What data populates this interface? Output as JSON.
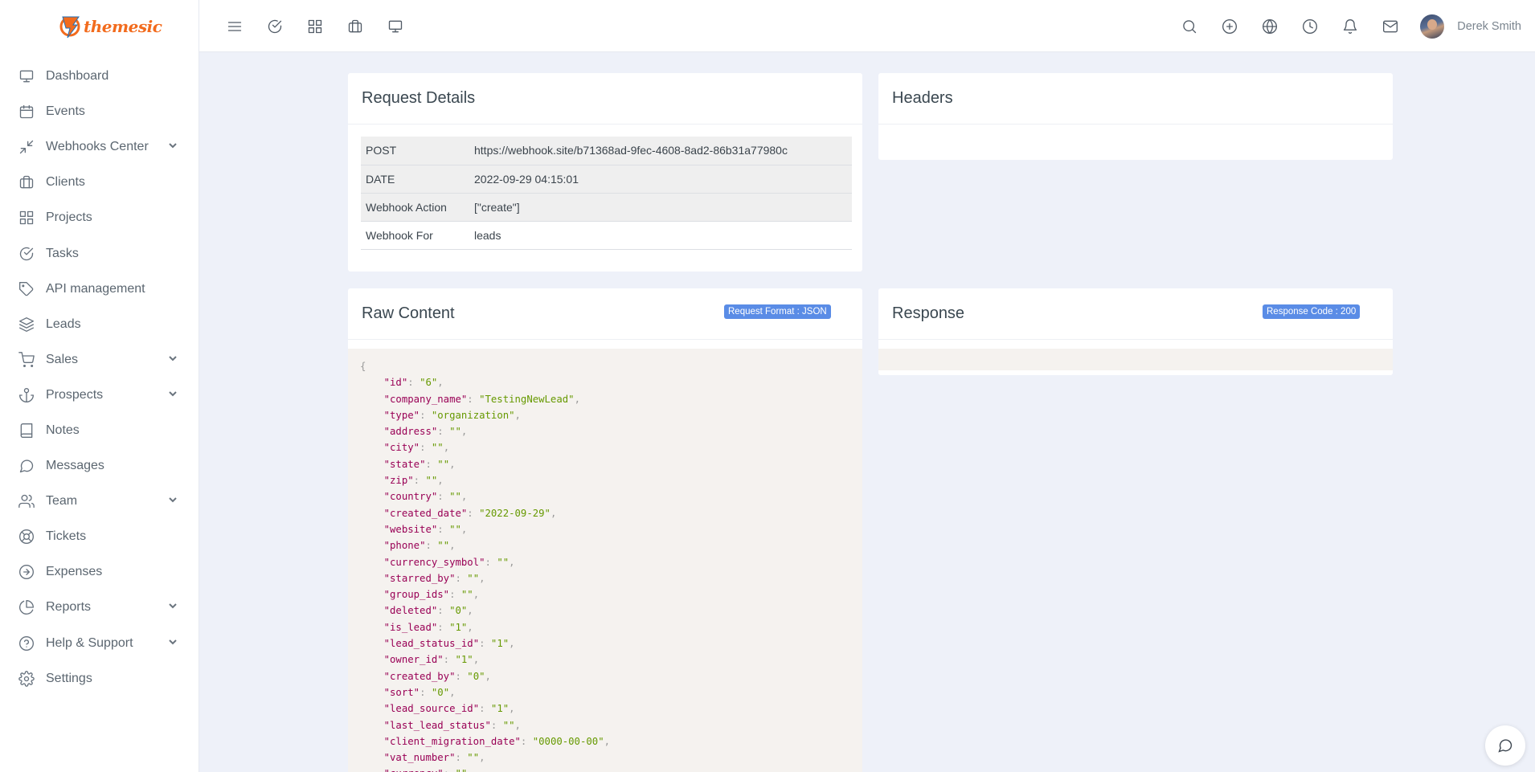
{
  "brand": {
    "name": "themesic",
    "logo_icon": "lightning-bolt-logo"
  },
  "sidebar": {
    "items": [
      {
        "label": "Dashboard",
        "icon": "monitor-icon",
        "has_children": false
      },
      {
        "label": "Events",
        "icon": "calendar-icon",
        "has_children": false
      },
      {
        "label": "Webhooks Center",
        "icon": "compress-arrows-icon",
        "has_children": true
      },
      {
        "label": "Clients",
        "icon": "briefcase-icon",
        "has_children": false
      },
      {
        "label": "Projects",
        "icon": "grid-icon",
        "has_children": false
      },
      {
        "label": "Tasks",
        "icon": "check-circle-icon",
        "has_children": false
      },
      {
        "label": "API management",
        "icon": "tag-icon",
        "has_children": false
      },
      {
        "label": "Leads",
        "icon": "layers-icon",
        "has_children": false
      },
      {
        "label": "Sales",
        "icon": "cart-icon",
        "has_children": true
      },
      {
        "label": "Prospects",
        "icon": "anchor-icon",
        "has_children": true
      },
      {
        "label": "Notes",
        "icon": "book-icon",
        "has_children": false
      },
      {
        "label": "Messages",
        "icon": "message-circle-icon",
        "has_children": false
      },
      {
        "label": "Team",
        "icon": "users-icon",
        "has_children": true
      },
      {
        "label": "Tickets",
        "icon": "life-buoy-icon",
        "has_children": false
      },
      {
        "label": "Expenses",
        "icon": "arrow-right-circle-icon",
        "has_children": false
      },
      {
        "label": "Reports",
        "icon": "pie-chart-icon",
        "has_children": true
      },
      {
        "label": "Help & Support",
        "icon": "help-circle-icon",
        "has_children": true
      },
      {
        "label": "Settings",
        "icon": "settings-icon",
        "has_children": false
      }
    ]
  },
  "topbar": {
    "left_icons": [
      "menu-icon",
      "check-circle-icon",
      "grid-icon",
      "briefcase-icon",
      "monitor-icon"
    ],
    "right_icons": [
      "search-icon",
      "plus-circle-icon",
      "globe-icon",
      "clock-icon",
      "bell-icon",
      "mail-icon"
    ],
    "user_name": "Derek Smith"
  },
  "request_details": {
    "title": "Request Details",
    "rows": [
      {
        "key": "POST",
        "value": "https://webhook.site/b71368ad-9fec-4608-8ad2-86b31a77980c"
      },
      {
        "key": "DATE",
        "value": "2022-09-29 04:15:01"
      },
      {
        "key": "Webhook Action",
        "value": "[\"create\"]"
      },
      {
        "key": "Webhook For",
        "value": "leads"
      }
    ]
  },
  "headers": {
    "title": "Headers"
  },
  "raw_content": {
    "title": "Raw Content",
    "badge": "Request Format : JSON",
    "open_brace": "{",
    "fields": [
      {
        "key": "id",
        "value": "6"
      },
      {
        "key": "company_name",
        "value": "TestingNewLead"
      },
      {
        "key": "type",
        "value": "organization"
      },
      {
        "key": "address",
        "value": ""
      },
      {
        "key": "city",
        "value": ""
      },
      {
        "key": "state",
        "value": ""
      },
      {
        "key": "zip",
        "value": ""
      },
      {
        "key": "country",
        "value": ""
      },
      {
        "key": "created_date",
        "value": "2022-09-29"
      },
      {
        "key": "website",
        "value": ""
      },
      {
        "key": "phone",
        "value": ""
      },
      {
        "key": "currency_symbol",
        "value": ""
      },
      {
        "key": "starred_by",
        "value": ""
      },
      {
        "key": "group_ids",
        "value": ""
      },
      {
        "key": "deleted",
        "value": "0"
      },
      {
        "key": "is_lead",
        "value": "1"
      },
      {
        "key": "lead_status_id",
        "value": "1"
      },
      {
        "key": "owner_id",
        "value": "1"
      },
      {
        "key": "created_by",
        "value": "0"
      },
      {
        "key": "sort",
        "value": "0"
      },
      {
        "key": "lead_source_id",
        "value": "1"
      },
      {
        "key": "last_lead_status",
        "value": ""
      },
      {
        "key": "client_migration_date",
        "value": "0000-00-00"
      },
      {
        "key": "vat_number",
        "value": ""
      },
      {
        "key": "currency",
        "value": ""
      }
    ]
  },
  "response": {
    "title": "Response",
    "badge": "Response Code : 200"
  },
  "chat": {
    "icon": "chat-bubble-icon"
  }
}
